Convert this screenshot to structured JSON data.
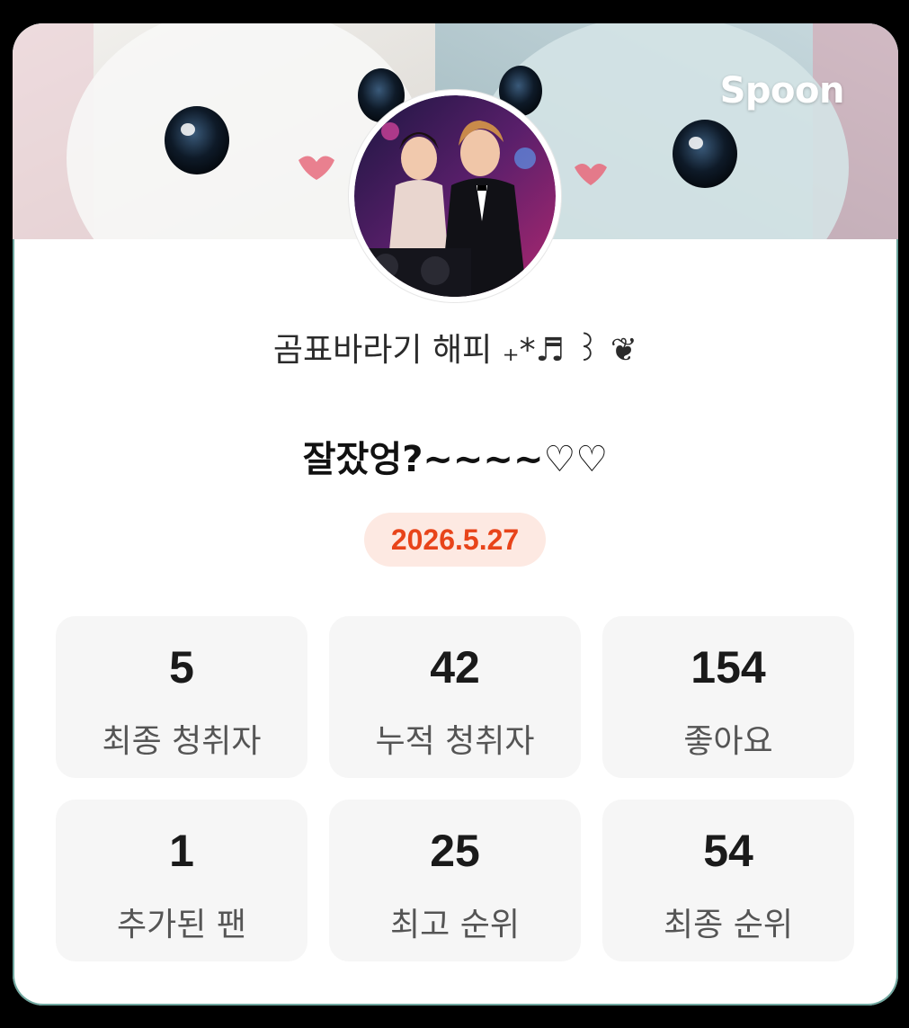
{
  "brand": "Spoon",
  "profile": {
    "nickname": "곰표바라기 해피 ₊*♬ ꒱ ❦",
    "avatar_icon": "avatar-photo-couple"
  },
  "broadcast": {
    "title": "잘잤엉?~~~~♡♡",
    "date": "2026.5.27"
  },
  "stats": [
    {
      "value": "5",
      "label": "최종 청취자"
    },
    {
      "value": "42",
      "label": "누적 청취자"
    },
    {
      "value": "154",
      "label": "좋아요"
    },
    {
      "value": "1",
      "label": "추가된 팬"
    },
    {
      "value": "25",
      "label": "최고 순위"
    },
    {
      "value": "54",
      "label": "최종 순위"
    }
  ],
  "colors": {
    "accent": "#e8441a",
    "pill_bg": "#fde9e2",
    "card_bg": "#ffffff",
    "stat_bg": "#f6f6f6"
  }
}
